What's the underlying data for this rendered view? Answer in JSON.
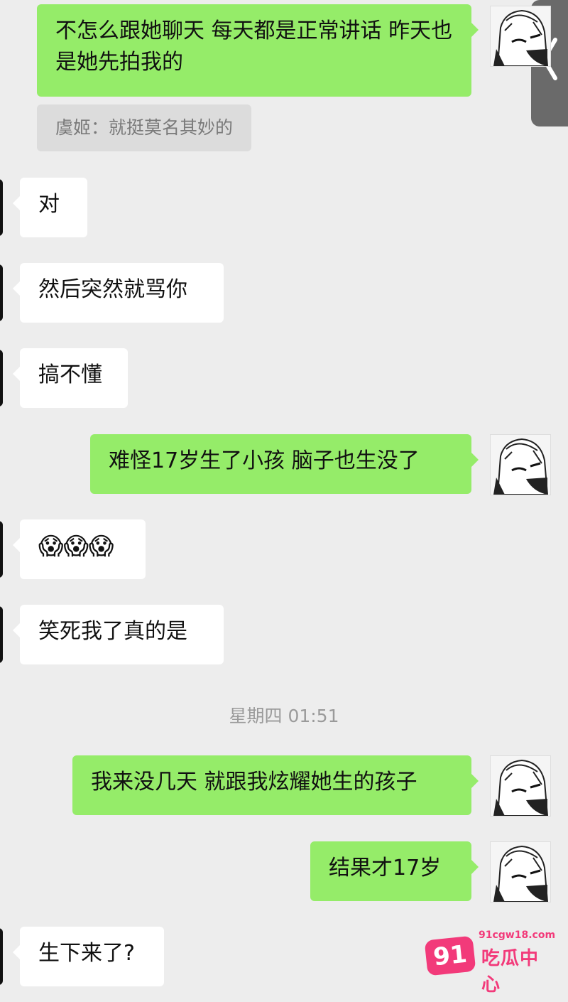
{
  "messages": [
    {
      "side": "out",
      "text": "不怎么跟她聊天  每天都是正常讲话 昨天也是她先拍我的"
    },
    {
      "side": "quote",
      "text": "虞姬：就挺莫名其妙的"
    },
    {
      "side": "in",
      "text": "对"
    },
    {
      "side": "in",
      "text": "然后突然就骂你"
    },
    {
      "side": "in",
      "text": "搞不懂"
    },
    {
      "side": "out",
      "text": "难怪17岁生了小孩 脑子也生没了"
    },
    {
      "side": "in",
      "text": "😱😱😱"
    },
    {
      "side": "in",
      "text": "笑死我了真的是"
    },
    {
      "side": "time",
      "text": "星期四 01:51"
    },
    {
      "side": "out",
      "text": "我来没几天 就跟我炫耀她生的孩子"
    },
    {
      "side": "out",
      "text": "结果才17岁"
    },
    {
      "side": "in",
      "text": "生下来了?"
    }
  ],
  "watermark": {
    "badge": "91",
    "url": "91cgw18.com",
    "name": "吃瓜中心"
  },
  "colors": {
    "outgoing": "#95ec69",
    "incoming": "#ffffff",
    "background": "#ededed",
    "watermark": "#f23a7a"
  },
  "icons": {
    "side_tab": "chevron-left-icon",
    "avatar": "anime-avatar-icon"
  }
}
